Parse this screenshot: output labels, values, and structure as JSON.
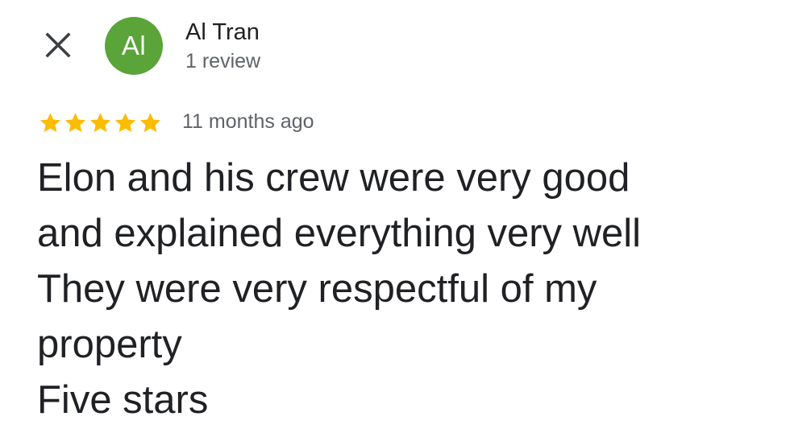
{
  "header": {
    "close_icon": "close-icon",
    "avatar_initials": "Al",
    "avatar_color": "#5aa43a",
    "author_name": "Al Tran",
    "author_meta": "1 review"
  },
  "review": {
    "rating": 5,
    "rating_max": 5,
    "star_color": "#fbbc04",
    "timestamp": "11 months ago",
    "lines": [
      "Elon and his crew were very good",
      "and explained everything very well",
      "They were very respectful of my",
      "property",
      "Five stars"
    ]
  }
}
